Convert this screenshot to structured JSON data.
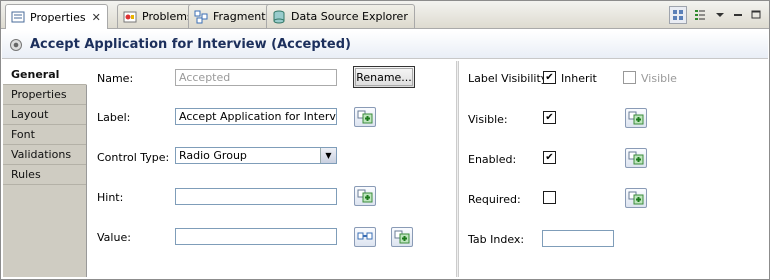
{
  "tabs": [
    {
      "label": "Properties",
      "close": "✕"
    },
    {
      "label": "Problems"
    },
    {
      "label": "Fragments"
    },
    {
      "label": "Data Source Explorer"
    }
  ],
  "header": {
    "title": "Accept Application for Interview (Accepted)"
  },
  "side_tabs": [
    "General",
    "Properties",
    "Layout",
    "Font",
    "Validations",
    "Rules"
  ],
  "form": {
    "name_label": "Name:",
    "name_value": "Accepted",
    "rename_label": "Rename...",
    "label_label": "Label:",
    "label_value": "Accept Application for Interview",
    "control_type_label": "Control Type:",
    "control_type_value": "Radio Group",
    "hint_label": "Hint:",
    "hint_value": "",
    "value_label": "Value:",
    "value_value": ""
  },
  "right": {
    "label_visibility_label": "Label Visibility:",
    "inherit_label": "Inherit",
    "inherit_checked": true,
    "visible_option_label": "Visible",
    "visible_option_checked": false,
    "visible_label": "Visible:",
    "visible_checked": true,
    "enabled_label": "Enabled:",
    "enabled_checked": true,
    "required_label": "Required:",
    "required_checked": false,
    "tab_index_label": "Tab Index:",
    "tab_index_value": ""
  },
  "icons": {
    "check_glyph": "✔",
    "dropdown_glyph": "▼"
  }
}
